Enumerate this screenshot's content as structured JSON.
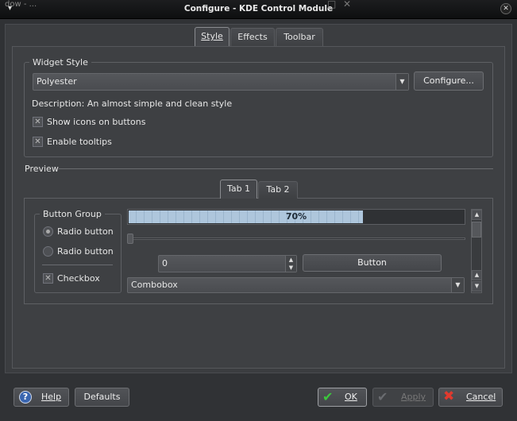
{
  "window": {
    "title": "Configure - KDE Control Module",
    "background_fragment": "dow - ...",
    "close_glyph": "✕",
    "minimize_glyph": "□",
    "menu_glyph": "▾"
  },
  "tabs": [
    {
      "label": "Style",
      "active": true
    },
    {
      "label": "Effects",
      "active": false
    },
    {
      "label": "Toolbar",
      "active": false
    }
  ],
  "widget_style": {
    "legend": "Widget Style",
    "selected": "Polyester",
    "configure_label": "Configure...",
    "description": "Description: An almost simple and clean style",
    "show_icons": {
      "label": "Show icons on buttons",
      "checked": true
    },
    "enable_tooltips": {
      "label": "Enable tooltips",
      "checked": true
    }
  },
  "preview": {
    "title": "Preview",
    "tabs": [
      {
        "label": "Tab 1",
        "active": true
      },
      {
        "label": "Tab 2",
        "active": false
      }
    ],
    "button_group": {
      "legend": "Button Group",
      "radio1": "Radio button",
      "radio2": "Radio button",
      "checkbox": "Checkbox"
    },
    "progress": {
      "value": 0.7,
      "label": "70%"
    },
    "slider_value": 0,
    "spinbox_value": "0",
    "button_label": "Button",
    "combobox_value": "Combobox"
  },
  "footer": {
    "help": "Help",
    "defaults": "Defaults",
    "ok": "OK",
    "apply": "Apply",
    "cancel": "Cancel"
  },
  "colors": {
    "ok_icon": "#3cc83c",
    "cancel_icon": "#e03a2e",
    "help_icon": "#3a66b0",
    "progress_fill": "#a9c1d9"
  }
}
